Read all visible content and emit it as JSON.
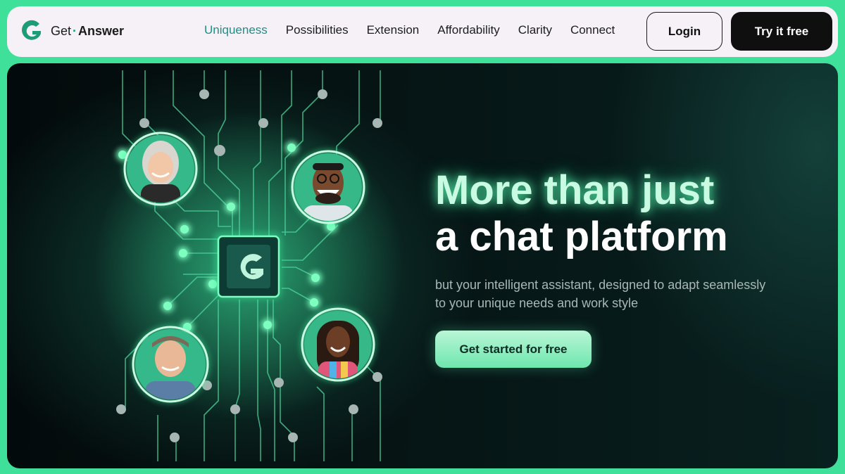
{
  "brand": {
    "name_part1": "Get",
    "separator": "·",
    "name_part2": "Answer",
    "logo_icon": "g-logo-icon"
  },
  "nav": {
    "links": [
      {
        "label": "Uniqueness",
        "active": true
      },
      {
        "label": "Possibilities",
        "active": false
      },
      {
        "label": "Extension",
        "active": false
      },
      {
        "label": "Affordability",
        "active": false
      },
      {
        "label": "Clarity",
        "active": false
      },
      {
        "label": "Connect",
        "active": false
      }
    ],
    "login_label": "Login",
    "try_label": "Try it free"
  },
  "hero": {
    "headline_line1": "More than just",
    "headline_line2": "a chat platform",
    "subtext": "but your intelligent assistant, designed to adapt seamlessly to your unique needs and work style",
    "cta_label": "Get started for free",
    "center_icon": "g-chip-icon",
    "avatars": [
      "avatar-woman-blonde",
      "avatar-man-glasses",
      "avatar-man-cap",
      "avatar-woman-braids"
    ]
  },
  "colors": {
    "page_bg": "#3fe09a",
    "nav_bg": "#f5f1f6",
    "accent": "#1f8f86",
    "hero_bg": "#061414",
    "glow_green": "#5cff9f",
    "cta_bg": "#8ef0c0"
  }
}
